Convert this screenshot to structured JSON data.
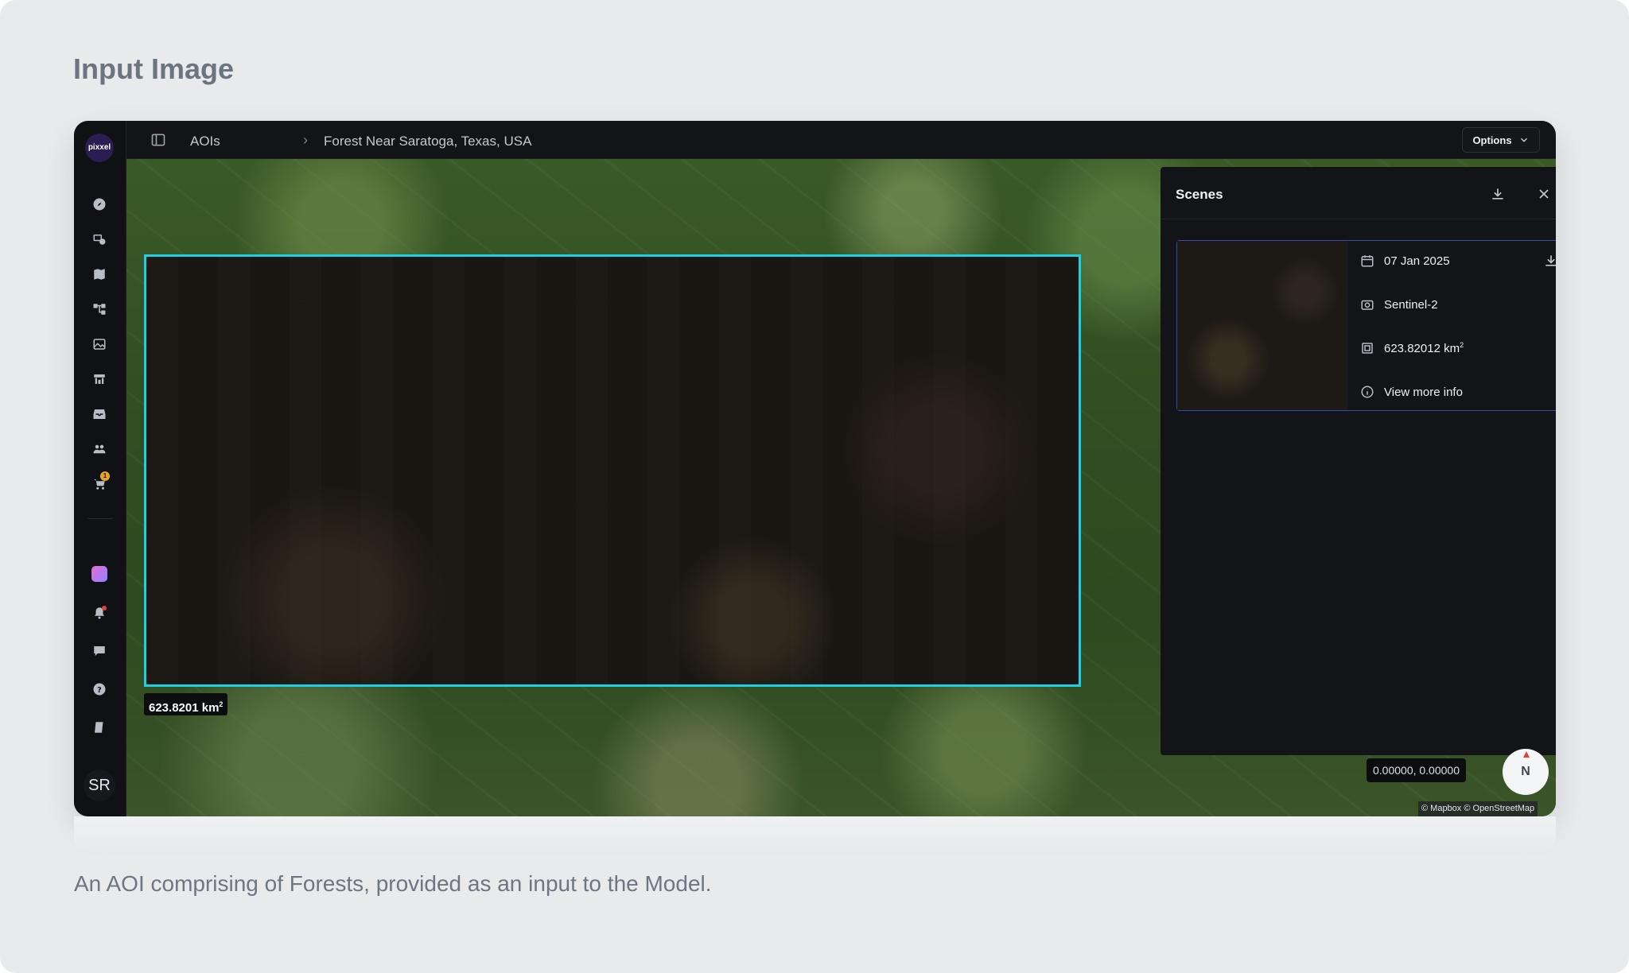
{
  "page": {
    "title": "Input Image",
    "caption": "An AOI comprising of Forests, provided as an input to the Model."
  },
  "app": {
    "logo_text": "pixxel",
    "avatar_initials": "SR",
    "cart_badge": "1"
  },
  "rail": {
    "icons": [
      "compass-icon",
      "satellite-icon",
      "map-icon",
      "workflow-icon",
      "image-icon",
      "store-icon",
      "inbox-icon",
      "team-icon",
      "cart-icon"
    ],
    "bottom_icons": [
      "gradient-app-icon",
      "bell-icon",
      "chat-icon",
      "help-icon",
      "docs-icon"
    ]
  },
  "header": {
    "breadcrumb_root": "AOIs",
    "breadcrumb_separator": "›",
    "breadcrumb_current": "Forest Near Saratoga, Texas, USA",
    "options_label": "Options"
  },
  "map": {
    "area_value": "623.8201 km",
    "area_exp": "2",
    "coordinates": "0.00000, 0.00000",
    "compass_label": "N",
    "attribution": "© Mapbox © OpenStreetMap"
  },
  "scenes": {
    "title": "Scenes",
    "items": [
      {
        "date": "07 Jan 2025",
        "sensor": "Sentinel-2",
        "area_value": "623.82012 km",
        "area_exp": "2",
        "more_info": "View more info"
      }
    ]
  },
  "colors": {
    "aoi_outline": "#19d0e6",
    "selected_card_border": "#3a4aa8",
    "active_tool": "#1f3f7f",
    "badge": "#e8a51f"
  }
}
